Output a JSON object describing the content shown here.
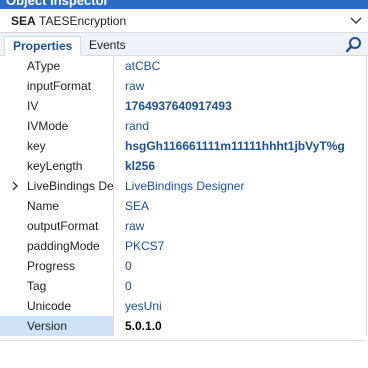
{
  "window": {
    "title": "Object Inspector"
  },
  "object_selector": {
    "name": "SEA",
    "type": "TAESEncryption"
  },
  "tabs": [
    {
      "label": "Properties",
      "active": true
    },
    {
      "label": "Events",
      "active": false
    }
  ],
  "properties": [
    {
      "name": "AType",
      "value": "atCBC",
      "bold": false
    },
    {
      "name": "inputFormat",
      "value": "raw",
      "bold": false
    },
    {
      "name": "IV",
      "value": "1764937640917493",
      "bold": true
    },
    {
      "name": "IVMode",
      "value": "rand",
      "bold": false
    },
    {
      "name": "key",
      "value": "hsgGh116661111m11111hhht1jbVyT%g",
      "bold": true
    },
    {
      "name": "keyLength",
      "value": "kl256",
      "bold": true
    },
    {
      "name": "LiveBindings Designer",
      "value": "LiveBindings Designer",
      "bold": false,
      "expandable": true
    },
    {
      "name": "Name",
      "value": "SEA",
      "bold": false
    },
    {
      "name": "outputFormat",
      "value": "raw",
      "bold": false
    },
    {
      "name": "paddingMode",
      "value": "PKCS7",
      "bold": false
    },
    {
      "name": "Progress",
      "value": "0",
      "bold": false
    },
    {
      "name": "Tag",
      "value": "0",
      "bold": false
    },
    {
      "name": "Unicode",
      "value": "yesUni",
      "bold": false
    },
    {
      "name": "Version",
      "value": "5.0.1.0",
      "bold": true,
      "selected": true
    }
  ],
  "colors": {
    "accent": "#2b6cc4",
    "value_text": "#1a4f99",
    "selection": "#cfe3f8"
  }
}
